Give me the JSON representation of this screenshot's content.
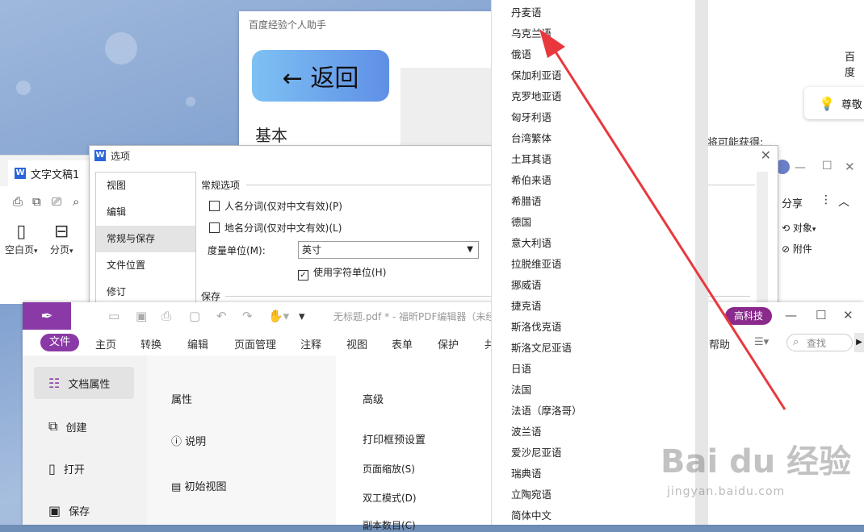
{
  "assistant": {
    "title": "百度经验个人助手",
    "back_label": "← 返回",
    "section_basic": "基本"
  },
  "right_page": {
    "text_top": "百度",
    "tip_label": "尊敬",
    "text_mid": "将可能获得:"
  },
  "wps": {
    "tab_label": "文字文稿1",
    "share_label": "分享",
    "ribbon": [
      {
        "icon": "blank-page-icon",
        "label": "空白页"
      },
      {
        "icon": "page-break-icon",
        "label": "分页"
      }
    ],
    "ribbon_right": [
      {
        "icon": "object-icon",
        "label": "对象"
      },
      {
        "icon": "attachment-icon",
        "label": "附件"
      }
    ]
  },
  "options_dialog": {
    "title": "选项",
    "nav": [
      "视图",
      "编辑",
      "常规与保存",
      "文件位置",
      "修订"
    ],
    "selected_nav": "常规与保存",
    "group_general": "常规选项",
    "opt_person": "人名分词(仅对中文有效)(P)",
    "opt_place": "地名分词(仅对中文有效)(L)",
    "unit_label": "度量单位(M):",
    "unit_value": "英寸",
    "opt_char_unit": "使用字符单位(H)",
    "group_save": "保存"
  },
  "pdf_editor": {
    "window_title": "无标题.pdf * - 福昕PDF编辑器（未经",
    "badge": "高科技",
    "menu": [
      "文件",
      "主页",
      "转换",
      "编辑",
      "页面管理",
      "注释",
      "视图",
      "表单",
      "保护",
      "共"
    ],
    "menu_help": "帮助",
    "search_placeholder": "查找",
    "side": [
      {
        "icon": "doc-properties-icon",
        "label": "文档属性"
      },
      {
        "icon": "create-icon",
        "label": "创建"
      },
      {
        "icon": "open-icon",
        "label": "打开"
      },
      {
        "icon": "save-icon",
        "label": "保存"
      }
    ],
    "mid": [
      "属性",
      "说明",
      "初始视图"
    ],
    "main": [
      "高级",
      "打印框预设置",
      "页面缩放(S)",
      "双工模式(D)",
      "副本数目(C)"
    ]
  },
  "languages": [
    "丹麦语",
    "乌克兰语",
    "俄语",
    "保加利亚语",
    "克罗地亚语",
    "匈牙利语",
    "台湾繁体",
    "土耳其语",
    "希伯来语",
    "希腊语",
    "德国",
    "意大利语",
    "拉脱维亚语",
    "挪威语",
    "捷克语",
    "斯洛伐克语",
    "斯洛文尼亚语",
    "日语",
    "法国",
    "法语（摩洛哥）",
    "波兰语",
    "爱沙尼亚语",
    "瑞典语",
    "立陶宛语",
    "简体中文"
  ],
  "watermark": {
    "logo": "Bai du 经验",
    "url": "jingyan.baidu.com"
  },
  "colors": {
    "foxit_purple": "#8a3aa6",
    "arrow_red": "#e8383d",
    "back_gradient_start": "#7ec1f4",
    "back_gradient_end": "#5f8fe6"
  }
}
